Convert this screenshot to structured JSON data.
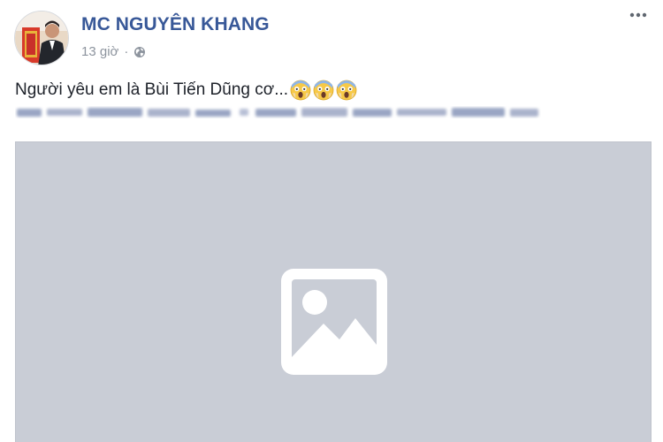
{
  "post": {
    "author": "MC NGUYÊN KHANG",
    "time": "13 giờ",
    "separator": "·",
    "privacy_icon": "globe-icon",
    "text": "Người yêu em là Bùi Tiến Dũng cơ...",
    "emojis": [
      "face-screaming-in-fear-icon",
      "face-screaming-in-fear-icon",
      "face-screaming-in-fear-icon"
    ],
    "media_icon": "image-placeholder-icon"
  },
  "colors": {
    "author": "#385898",
    "meta": "#8d949e",
    "text": "#1d2129",
    "media_bg": "#c9cdd6"
  }
}
